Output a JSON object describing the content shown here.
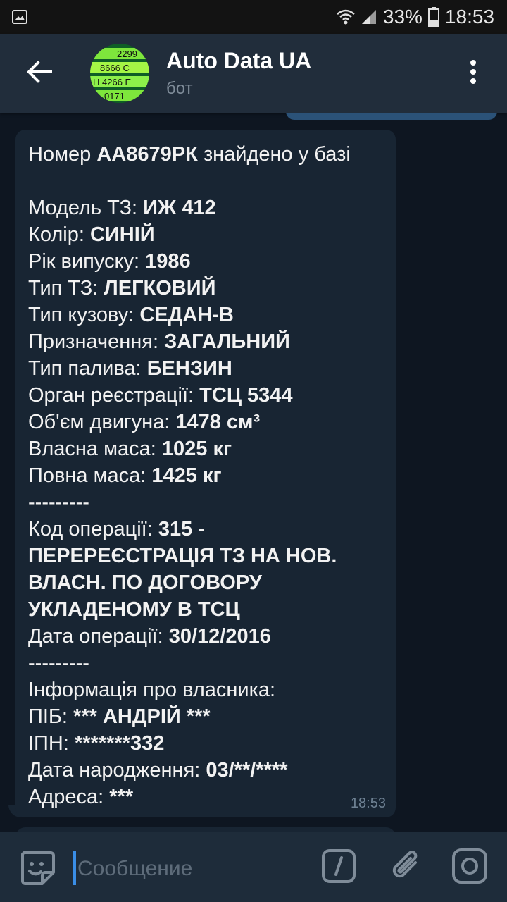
{
  "status_bar": {
    "battery": "33%",
    "time": "18:53"
  },
  "header": {
    "title": "Auto Data UA",
    "subtitle": "бот"
  },
  "avatar": {
    "plate_lines": [
      "2299",
      "8666 C",
      "H 4266 E",
      "0171"
    ]
  },
  "message": {
    "time": "18:53",
    "lines": [
      [
        {
          "t": "Номер "
        },
        {
          "t": "АА8679РК",
          "b": true
        },
        {
          "t": " знайдено у базі"
        }
      ],
      [],
      [
        {
          "t": "Модель ТЗ: "
        },
        {
          "t": "ИЖ 412",
          "b": true
        }
      ],
      [
        {
          "t": "Колір: "
        },
        {
          "t": "СИНІЙ",
          "b": true
        }
      ],
      [
        {
          "t": "Рік випуску: "
        },
        {
          "t": "1986",
          "b": true
        }
      ],
      [
        {
          "t": "Тип ТЗ: "
        },
        {
          "t": "ЛЕГКОВИЙ",
          "b": true
        }
      ],
      [
        {
          "t": "Тип кузову: "
        },
        {
          "t": "СЕДАН-В",
          "b": true
        }
      ],
      [
        {
          "t": "Призначення: "
        },
        {
          "t": "ЗАГАЛЬНИЙ",
          "b": true
        }
      ],
      [
        {
          "t": "Тип палива: "
        },
        {
          "t": "БЕНЗИН",
          "b": true
        }
      ],
      [
        {
          "t": "Орган реєстрації: "
        },
        {
          "t": "ТСЦ 5344",
          "b": true
        }
      ],
      [
        {
          "t": "Об'єм двигуна: "
        },
        {
          "t": "1478 см³",
          "b": true
        }
      ],
      [
        {
          "t": "Власна маса: "
        },
        {
          "t": "1025 кг",
          "b": true
        }
      ],
      [
        {
          "t": "Повна маса: "
        },
        {
          "t": "1425 кг",
          "b": true
        }
      ],
      [
        {
          "t": "---------"
        }
      ],
      [
        {
          "t": "Код операції: "
        },
        {
          "t": "315 -",
          "b": true
        }
      ],
      [
        {
          "t": "ПЕРЕРЕЄСТРАЦІЯ ТЗ НА НОВ.",
          "b": true
        }
      ],
      [
        {
          "t": "ВЛАСН. ПО ДОГОВОРУ",
          "b": true
        }
      ],
      [
        {
          "t": "УКЛАДЕНОМУ В ТСЦ",
          "b": true
        }
      ],
      [
        {
          "t": "Дата операції: "
        },
        {
          "t": "30/12/2016",
          "b": true
        }
      ],
      [
        {
          "t": "---------"
        }
      ],
      [
        {
          "t": "Інформація про власника:"
        }
      ],
      [
        {
          "t": "ПІБ: "
        },
        {
          "t": "*** АНДРІЙ ***",
          "b": true
        }
      ],
      [
        {
          "t": "ІПН: "
        },
        {
          "t": "*******332",
          "b": true
        }
      ],
      [
        {
          "t": "Дата народження: "
        },
        {
          "t": "03/**/****",
          "b": true
        }
      ],
      [
        {
          "t": "Адреса: "
        },
        {
          "t": "***",
          "b": true
        }
      ]
    ]
  },
  "input": {
    "placeholder": "Сообщение"
  },
  "colors": {
    "chat_background": "#0e1621",
    "header": "#212d3b",
    "incoming_bubble": "#182533",
    "outgoing_bubble": "#2b5278",
    "input_bar": "#1e2c3a",
    "accent": "#3a8ee6"
  },
  "icons": {
    "status_left": "image-icon",
    "wifi": "wifi-icon",
    "signal": "signal-icon",
    "battery": "battery-icon",
    "back": "arrow-left-icon",
    "menu": "more-vertical-icon",
    "emoji": "sticker-icon",
    "commands": "slash-command-icon",
    "attach": "paperclip-icon",
    "camera": "camera-icon"
  }
}
